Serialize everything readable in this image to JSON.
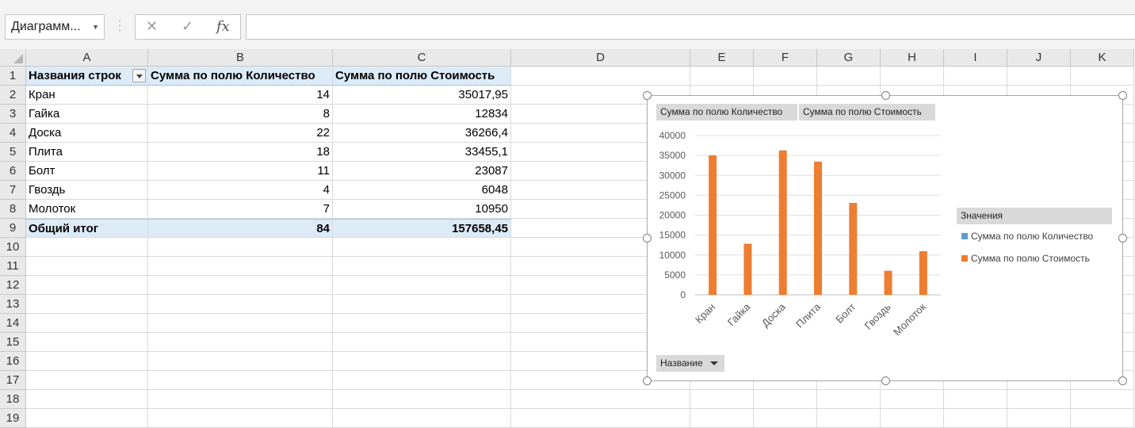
{
  "formula_bar": {
    "name_box": "Диаграмм...",
    "cancel_icon": "✕",
    "enter_icon": "✓",
    "fx_label": "fx",
    "formula": ""
  },
  "columns": [
    "A",
    "B",
    "C",
    "D",
    "E",
    "F",
    "G",
    "H",
    "I",
    "J",
    "K"
  ],
  "rows": [
    "1",
    "2",
    "3",
    "4",
    "5",
    "6",
    "7",
    "8",
    "9",
    "10",
    "11",
    "12",
    "13",
    "14",
    "15",
    "16",
    "17",
    "18",
    "19"
  ],
  "pivot": {
    "headers": [
      "Названия строк",
      "Сумма по полю Количество",
      "Сумма по полю Стоимость"
    ],
    "data": [
      [
        "Кран",
        "14",
        "35017,95"
      ],
      [
        "Гайка",
        "8",
        "12834"
      ],
      [
        "Доска",
        "22",
        "36266,4"
      ],
      [
        "Плита",
        "18",
        "33455,1"
      ],
      [
        "Болт",
        "11",
        "23087"
      ],
      [
        "Гвоздь",
        "4",
        "6048"
      ],
      [
        "Молоток",
        "7",
        "10950"
      ]
    ],
    "total": [
      "Общий итог",
      "84",
      "157658,45"
    ]
  },
  "chart": {
    "field_buttons": {
      "values1": "Сумма по полю Количество",
      "values2": "Сумма по полю Стоимость",
      "axis": "Название"
    },
    "legend_title": "Значения",
    "colors": {
      "series1": "#5b9bd5",
      "series2": "#ed7d31"
    }
  },
  "chart_data": {
    "type": "bar",
    "categories": [
      "Кран",
      "Гайка",
      "Доска",
      "Плита",
      "Болт",
      "Гвоздь",
      "Молоток"
    ],
    "series": [
      {
        "name": "Сумма по полю Количество",
        "values": [
          14,
          8,
          22,
          18,
          11,
          4,
          7
        ]
      },
      {
        "name": "Сумма по полю Стоимость",
        "values": [
          35017.95,
          12834,
          36266.4,
          33455.1,
          23087,
          6048,
          10950
        ]
      }
    ],
    "yticks": [
      "0",
      "5000",
      "10000",
      "15000",
      "20000",
      "25000",
      "30000",
      "35000",
      "40000"
    ],
    "ylim": [
      0,
      40000
    ],
    "grid": true,
    "legend_position": "right"
  }
}
